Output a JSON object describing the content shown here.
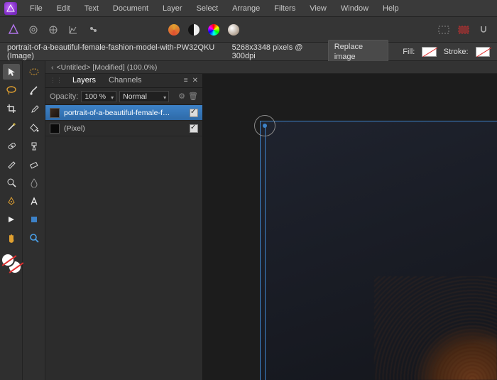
{
  "menu": {
    "items": [
      "File",
      "Edit",
      "Text",
      "Document",
      "Layer",
      "Select",
      "Arrange",
      "Filters",
      "View",
      "Window",
      "Help"
    ]
  },
  "context": {
    "document_label": "portrait-of-a-beautiful-female-fashion-model-with-PW32QKU (Image)",
    "dimensions": "5268x3348 pixels @ 300dpi",
    "replace_btn": "Replace image",
    "fill_label": "Fill:",
    "stroke_label": "Stroke:"
  },
  "doc_tab": "<Untitled> [Modified] (100.0%)",
  "layers_panel": {
    "tab_layers": "Layers",
    "tab_channels": "Channels",
    "opacity_label": "Opacity:",
    "opacity_value": "100 %",
    "blend_mode": "Normal",
    "items": [
      {
        "name": "portrait-of-a-beautiful-female-f…",
        "checked": true,
        "selected": true
      },
      {
        "name": "(Pixel)",
        "checked": true,
        "selected": false
      }
    ]
  },
  "colors": {
    "selection": "#3d82c8"
  }
}
